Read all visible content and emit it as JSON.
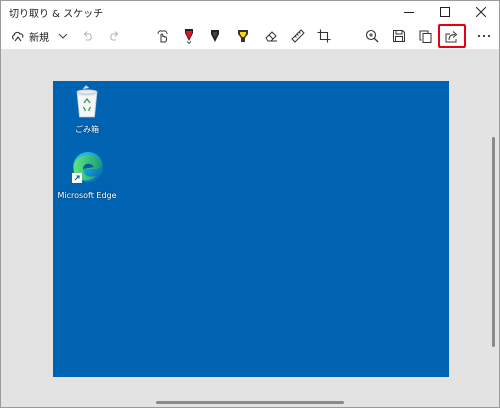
{
  "window": {
    "title": "切り取り & スケッチ",
    "controls": [
      "minimize-icon",
      "maximize-icon",
      "close-icon"
    ]
  },
  "toolbar": {
    "new_label": "新規",
    "buttons": [
      "new-snip-icon",
      "chevron-down-icon",
      "undo-icon",
      "redo-icon",
      "touch-writing-icon",
      "ballpoint-pen-icon",
      "pencil-icon",
      "highlighter-icon",
      "eraser-icon",
      "ruler-icon",
      "crop-icon",
      "zoom-icon",
      "save-icon",
      "copy-icon",
      "share-icon",
      "more-icon"
    ],
    "selected_tool": "ballpoint-pen-icon",
    "highlighted_button": "share-icon"
  },
  "desktop": {
    "icons": [
      {
        "label": "ごみ箱",
        "icon": "recycle-bin-icon"
      },
      {
        "label": "Microsoft Edge",
        "icon": "edge-icon"
      }
    ]
  },
  "colors": {
    "accent": "#0067c0",
    "highlight_box": "#e60012",
    "desktop_background": "#0063b1",
    "canvas_background": "#e3e3e3",
    "pen_red": "#e81123",
    "highlighter_yellow": "#ffd800"
  }
}
